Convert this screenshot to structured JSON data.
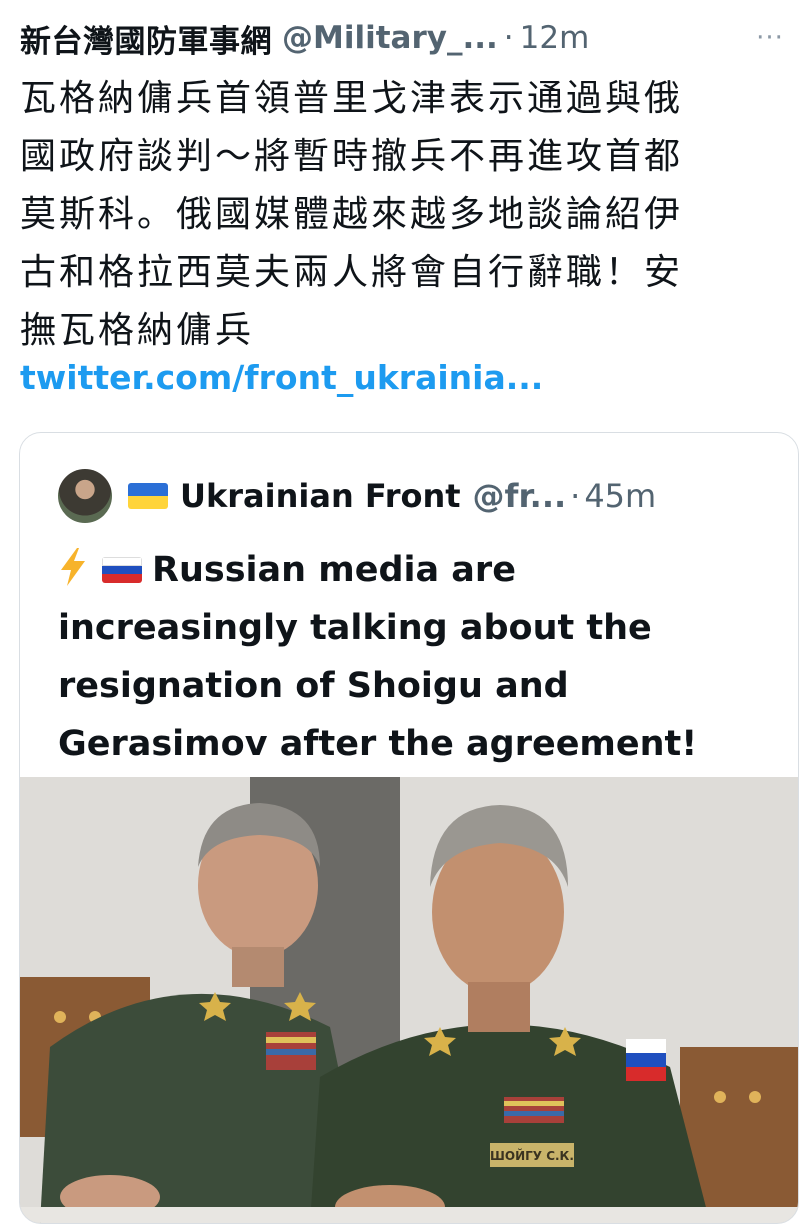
{
  "tweet": {
    "display_name": "新台灣國防軍事網",
    "handle": "@Military_...",
    "dot": "·",
    "time": "12m",
    "more_label": "···",
    "text": "瓦格納傭兵首領普里戈津表示通過與俄\n國政府談判～將暫時撤兵不再進攻首都\n莫斯科。俄國媒體越來越多地談論紹伊\n古和格拉西莫夫兩人將會自行辭職！安\n撫瓦格納傭兵",
    "link": "twitter.com/front_ukrainia..."
  },
  "quoted_tweet": {
    "display_name": "Ukrainian Front",
    "handle": "@fr...",
    "dot": "·",
    "time": "45m",
    "text_lines": [
      "Russian media are",
      "increasingly talking about the",
      "resignation of Shoigu and",
      "Gerasimov after the agreement!"
    ],
    "icons": [
      "lightning-emoji",
      "ukraine-flag",
      "russia-flag"
    ],
    "photo_labels": {
      "name_tag": "ШОЙГУ С.К."
    }
  },
  "colors": {
    "link": "#1d9bf0",
    "secondary_text": "#536471",
    "border": "#d9dee3",
    "uniform": "#3c4c3a",
    "bolt": "#f7b32b"
  }
}
